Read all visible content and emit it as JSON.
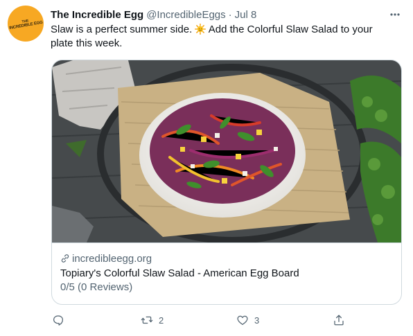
{
  "tweet": {
    "avatar": {
      "brand_top": "THE",
      "brand_name": "INCREDIBLE EGG"
    },
    "author_name": "The Incredible Egg",
    "handle": "@IncredibleEggs",
    "separator": "·",
    "date": "Jul 8",
    "text_part1": "Slaw is a perfect summer side.",
    "text_emoji": "sun-emoji",
    "text_part2": "Add the Colorful Slaw Salad to your plate this week.",
    "more_icon": "more-icon"
  },
  "card": {
    "image_icon": "salad-photo",
    "domain": "incredibleegg.org",
    "title": "Topiary's Colorful Slaw Salad - American Egg Board",
    "description": "0/5 (0 Reviews)"
  },
  "actions": {
    "reply": {
      "icon": "reply-icon",
      "count": ""
    },
    "retweet": {
      "icon": "retweet-icon",
      "count": "2"
    },
    "like": {
      "icon": "like-icon",
      "count": "3"
    },
    "share": {
      "icon": "share-icon",
      "count": ""
    }
  },
  "colors": {
    "text_primary": "#0f1419",
    "text_secondary": "#536471",
    "border": "#cfd9de",
    "avatar_bg": "#f7a823"
  }
}
